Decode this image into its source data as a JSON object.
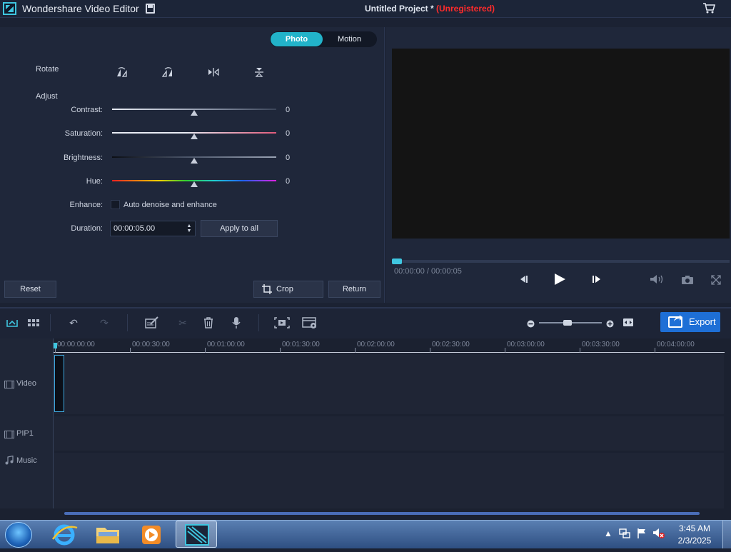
{
  "app": {
    "title": "Wondershare Video Editor",
    "project_title": "Untitled Project *",
    "registration_status": "(Unregistered)"
  },
  "colors": {
    "accent": "#22b3c9",
    "export": "#1e6fd6",
    "unregistered": "#ff2b2b",
    "panel": "#1f273a"
  },
  "settings": {
    "tabs": [
      {
        "label": "Photo",
        "active": true
      },
      {
        "label": "Motion",
        "active": false
      }
    ],
    "rotate_label": "Rotate",
    "rotate_icons": [
      "rotate-right-icon",
      "rotate-left-icon",
      "flip-horizontal-icon",
      "flip-vertical-icon"
    ],
    "adjust_label": "Adjust",
    "sliders": [
      {
        "label": "Contrast:",
        "value": "0",
        "level": 0.5
      },
      {
        "label": "Saturation:",
        "value": "0",
        "level": 0.5
      },
      {
        "label": "Brightness:",
        "value": "0",
        "level": 0.5
      },
      {
        "label": "Hue:",
        "value": "0",
        "level": 0.5
      }
    ],
    "enhance_label": "Enhance:",
    "enhance_option": "Auto denoise and enhance",
    "enhance_checked": false,
    "duration_label": "Duration:",
    "duration_value": "00:00:05.00",
    "apply_all_label": "Apply to all",
    "reset_label": "Reset",
    "crop_label": "Crop",
    "return_label": "Return"
  },
  "preview": {
    "timecode": "00:00:00 / 00:00:05",
    "progress": 0,
    "controls": [
      "step-back-icon",
      "play-icon",
      "step-forward-icon",
      "volume-icon",
      "snapshot-icon",
      "fullscreen-icon"
    ]
  },
  "timeline_toolbar": {
    "export_label": "Export",
    "icons": [
      "timeline-view-icon",
      "storyboard-view-icon",
      "undo-icon",
      "redo-icon",
      "edit-icon",
      "cut-icon",
      "delete-icon",
      "voiceover-icon",
      "crop-zoom-icon",
      "scene-detect-icon",
      "zoom-out-icon",
      "zoom-in-icon",
      "fit-icon"
    ],
    "zoom_level": 0.45
  },
  "timeline": {
    "ruler": [
      "00:00:00:00",
      "00:00:30:00",
      "00:01:00:00",
      "00:01:30:00",
      "00:02:00:00",
      "00:02:30:00",
      "00:03:00:00",
      "00:03:30:00",
      "00:04:00:00"
    ],
    "tracks": [
      {
        "label": "Video"
      },
      {
        "label": "PIP1"
      },
      {
        "label": "Music"
      }
    ]
  },
  "taskbar": {
    "apps": [
      "internet-explorer-icon",
      "file-explorer-icon",
      "media-player-icon",
      "wondershare-video-editor-icon"
    ],
    "time": "3:45 AM",
    "date": "2/3/2025"
  }
}
